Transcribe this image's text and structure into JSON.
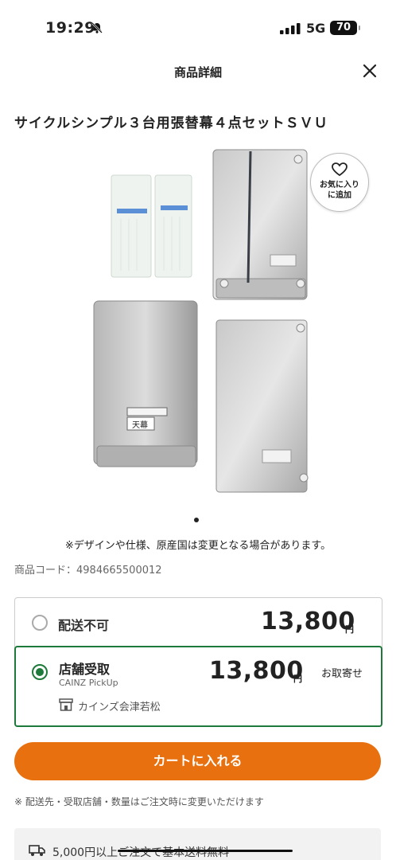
{
  "status_bar": {
    "time": "19:29",
    "network": "5G",
    "battery": "70"
  },
  "header": {
    "title": "商品詳細"
  },
  "product": {
    "title": "サイクルシンプル３台用張替幕４点セットＳＶＵ",
    "favorite_line1": "お気に入り",
    "favorite_line2": "に追加",
    "label_top": "天幕",
    "image_note": "※デザインや仕様、原産国は変更となる場合があります。",
    "code": "商品コード：4984665500012"
  },
  "delivery_options": [
    {
      "label": "配送不可",
      "price": "13,800",
      "yen": "円",
      "selected": false
    },
    {
      "label": "店舗受取",
      "sub": "CAINZ PickUp",
      "price": "13,800",
      "yen": "円",
      "note": "お取寄せ",
      "store": "カインズ会津若松",
      "selected": true
    }
  ],
  "cart": {
    "button": "カートに入れる",
    "note": "※ 配送先・受取店舗・数量はご注文時に変更いただけます"
  },
  "shipping": {
    "text": "5,000円以上ご注文で基本送料無料"
  },
  "colors": {
    "accent": "#e8700e",
    "selected": "#1e7a3a"
  }
}
